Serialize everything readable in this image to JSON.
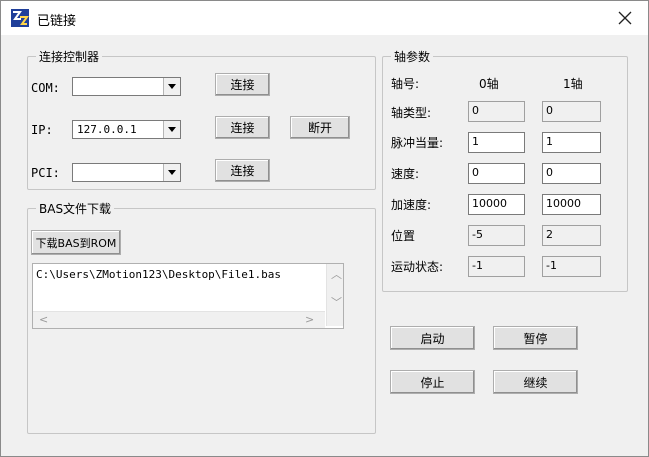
{
  "window": {
    "title": "已链接"
  },
  "connect": {
    "group_title": "连接控制器",
    "com_label": "COM:",
    "com_value": "",
    "ip_label": "IP:",
    "ip_value": "127.0.0.1",
    "pci_label": "PCI:",
    "pci_value": "",
    "connect_label": "连接",
    "disconnect_label": "断开"
  },
  "bas": {
    "group_title": "BAS文件下载",
    "download_label": "下载BAS到ROM",
    "file_path": "C:\\Users\\ZMotion123\\Desktop\\File1.bas"
  },
  "axis": {
    "group_title": "轴参数",
    "axis_no_label": "轴号:",
    "axis0_header": "0轴",
    "axis1_header": "1轴",
    "rows": [
      {
        "label": "轴类型:",
        "v0": "0",
        "v1": "0",
        "readonly": true
      },
      {
        "label": "脉冲当量:",
        "v0": "1",
        "v1": "1",
        "readonly": false
      },
      {
        "label": "速度:",
        "v0": "0",
        "v1": "0",
        "readonly": false
      },
      {
        "label": "加速度:",
        "v0": "10000",
        "v1": "10000",
        "readonly": false
      },
      {
        "label": "位置",
        "v0": "-5",
        "v1": "2",
        "readonly": true
      },
      {
        "label": "运动状态:",
        "v0": "-1",
        "v1": "-1",
        "readonly": true
      }
    ]
  },
  "controls": {
    "start_label": "启动",
    "pause_label": "暂停",
    "stop_label": "停止",
    "resume_label": "继续"
  },
  "icons": {
    "close": "close-icon",
    "app": "app-icon",
    "dropdown": "chevron-down-icon"
  }
}
